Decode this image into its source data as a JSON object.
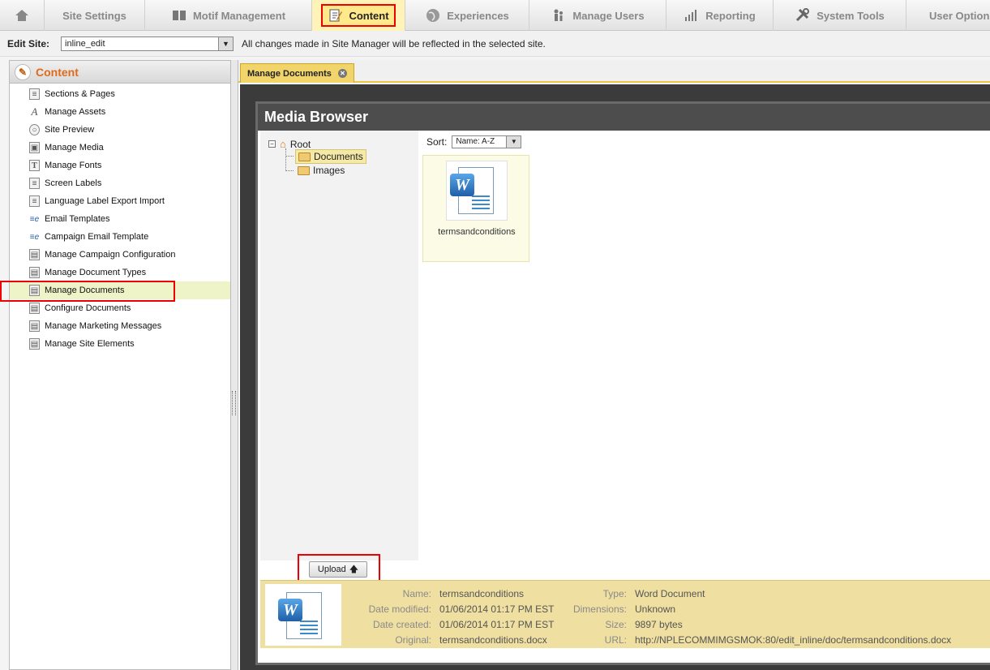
{
  "topnav": {
    "tabs": [
      {
        "label": "",
        "icon": "home-icon"
      },
      {
        "label": "Site Settings",
        "icon": ""
      },
      {
        "label": "Motif Management",
        "icon": "book-icon"
      },
      {
        "label": "Content",
        "icon": "content-edit-icon",
        "active": true
      },
      {
        "label": "Experiences",
        "icon": "globe-icon"
      },
      {
        "label": "Manage Users",
        "icon": "users-icon"
      },
      {
        "label": "Reporting",
        "icon": "bar-chart-icon"
      },
      {
        "label": "System Tools",
        "icon": "tools-icon"
      },
      {
        "label": "User Options",
        "icon": ""
      }
    ]
  },
  "sitebar": {
    "label": "Edit Site:",
    "selected_site": "inline_edit",
    "message": "All changes made in Site Manager will be reflected in the selected site."
  },
  "leftpanel": {
    "title": "Content",
    "items": [
      {
        "label": "Sections & Pages",
        "icon": "page-icon"
      },
      {
        "label": "Manage Assets",
        "icon": "asset-icon"
      },
      {
        "label": "Site Preview",
        "icon": "magnifier-icon"
      },
      {
        "label": "Manage Media",
        "icon": "media-icon"
      },
      {
        "label": "Manage Fonts",
        "icon": "font-icon"
      },
      {
        "label": "Screen Labels",
        "icon": "page-icon"
      },
      {
        "label": "Language Label Export Import",
        "icon": "page-icon"
      },
      {
        "label": "Email Templates",
        "icon": "email-icon"
      },
      {
        "label": "Campaign Email Template",
        "icon": "email-icon"
      },
      {
        "label": "Manage Campaign Configuration",
        "icon": "config-icon"
      },
      {
        "label": "Manage Document Types",
        "icon": "config-icon"
      },
      {
        "label": "Manage Documents",
        "icon": "config-icon",
        "selected": true
      },
      {
        "label": "Configure Documents",
        "icon": "config-icon"
      },
      {
        "label": "Manage Marketing Messages",
        "icon": "config-icon"
      },
      {
        "label": "Manage Site Elements",
        "icon": "config-icon"
      }
    ]
  },
  "main": {
    "tab_label": "Manage Documents"
  },
  "media_browser": {
    "title": "Media Browser",
    "tree": {
      "root": "Root",
      "children": [
        "Documents",
        "Images"
      ],
      "selected": "Documents"
    },
    "sort_label": "Sort:",
    "sort_value": "Name: A-Z",
    "files": [
      {
        "name": "termsandconditions",
        "icon": "word-document-icon"
      }
    ],
    "upload_label": "Upload",
    "details": {
      "name_label": "Name:",
      "name": "termsandconditions",
      "modified_label": "Date modified:",
      "modified": "01/06/2014 01:17 PM EST",
      "created_label": "Date created:",
      "created": "01/06/2014 01:17 PM EST",
      "original_label": "Original:",
      "original": "termsandconditions.docx",
      "type_label": "Type:",
      "type": "Word Document",
      "dimensions_label": "Dimensions:",
      "dimensions": "Unknown",
      "size_label": "Size:",
      "size": "9897 bytes",
      "url_label": "URL:",
      "url": "http://NPLECOMMIMGSMOK:80/edit_inline/doc/termsandconditions.docx"
    }
  },
  "colors": {
    "accent_orange": "#e06a1b",
    "active_tab": "#ffe98a",
    "highlight_red": "#ee0000",
    "details_bg": "#efdfa0"
  }
}
